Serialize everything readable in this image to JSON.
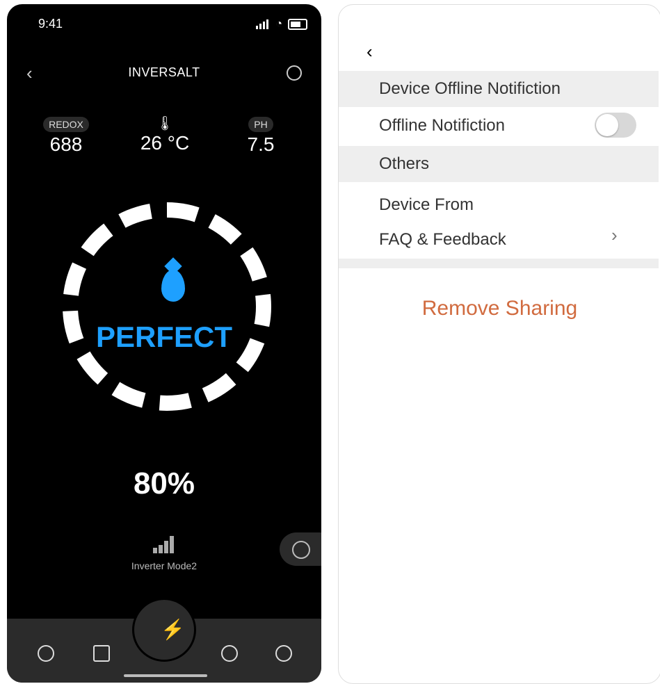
{
  "phone": {
    "status": {
      "time": "9:41"
    },
    "nav": {
      "back_symbol": "‹",
      "title": "INVERSALT"
    },
    "metrics": {
      "redox_label": "REDOX",
      "redox_value": "688",
      "temp_value": "26 °C",
      "ph_label": "PH",
      "ph_value": "7.5"
    },
    "ring_status": "PERFECT",
    "percent": "80%",
    "mode_label": "Inverter Mode2",
    "accent_color": "#1ea0ff"
  },
  "settings": {
    "back_symbol": "‹",
    "section_offline": "Device Offline Notifiction",
    "row_offline": "Offline Notifiction",
    "toggle_state": "off",
    "section_others": "Others",
    "row_device_from": "Device From",
    "row_faq": "FAQ & Feedback",
    "chevron": "›",
    "remove_sharing": "Remove Sharing",
    "remove_color": "#d16b3f"
  }
}
